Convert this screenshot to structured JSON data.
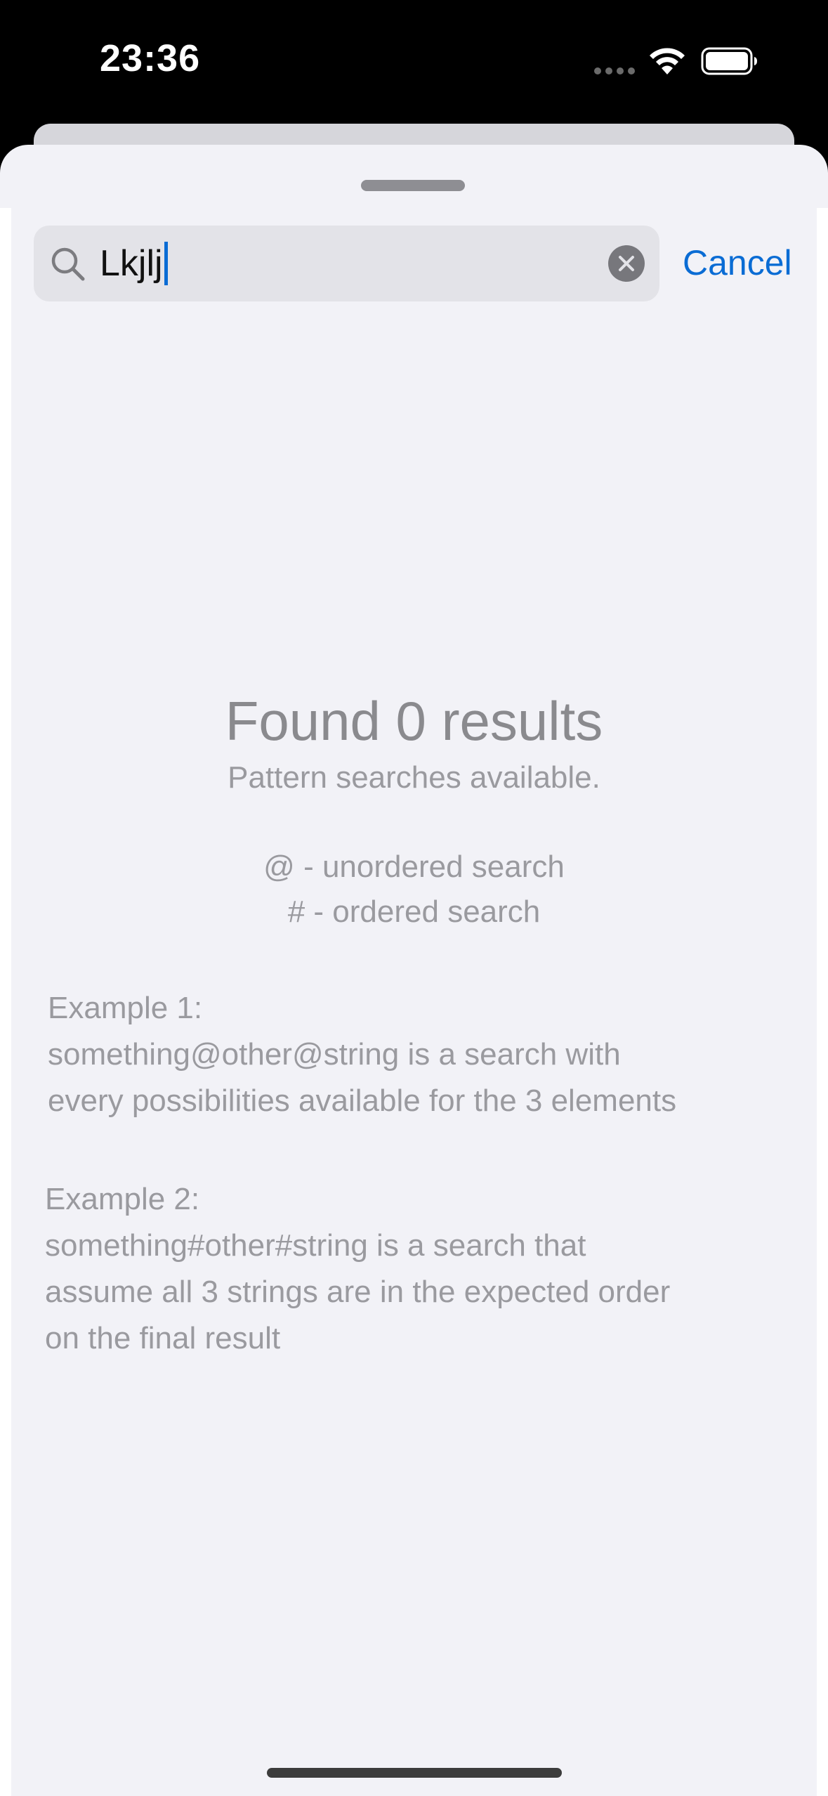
{
  "status_bar": {
    "time": "23:36"
  },
  "search": {
    "query": "Lkjlj",
    "cancel_label": "Cancel"
  },
  "empty_state": {
    "title": "Found 0 results",
    "subtitle": "Pattern searches available.",
    "hints": [
      "@ - unordered search",
      "# - ordered search"
    ],
    "examples": [
      {
        "lines": [
          "Example 1:",
          "something@other@string is a search with",
          "every possibilities available for the 3 elements"
        ]
      },
      {
        "lines": [
          "Example 2:",
          "something#other#string is a search that",
          "assume all 3 strings are in the expected order",
          "on the final result"
        ]
      }
    ]
  },
  "colors": {
    "accent": "#0a6cd4",
    "sheet_background": "#f2f2f7",
    "search_field": "#e3e3e8",
    "secondary_text": "#9a9a9f"
  },
  "icons": {
    "search": "search-icon",
    "clear": "clear-icon",
    "wifi": "wifi-icon",
    "battery": "battery-icon"
  }
}
